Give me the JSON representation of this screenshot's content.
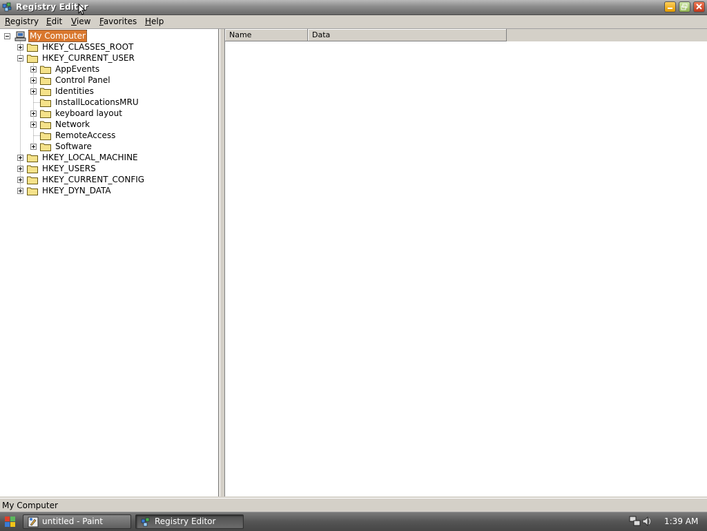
{
  "window": {
    "title": "Registry Editor",
    "buttons": [
      "minimize",
      "maximize",
      "close"
    ],
    "title_gradient": [
      "#b9b9b9",
      "#6a6a6a"
    ]
  },
  "menubar": {
    "items": [
      {
        "pre": "",
        "acc": "R",
        "post": "egistry"
      },
      {
        "pre": "",
        "acc": "E",
        "post": "dit"
      },
      {
        "pre": "",
        "acc": "V",
        "post": "iew"
      },
      {
        "pre": "",
        "acc": "F",
        "post": "avorites"
      },
      {
        "pre": "",
        "acc": "H",
        "post": "elp"
      }
    ]
  },
  "tree": {
    "root": {
      "label": "My Computer",
      "selected": true,
      "icon": "computer-icon"
    },
    "hives": [
      {
        "label": "HKEY_CLASSES_ROOT",
        "expander": "plus"
      },
      {
        "label": "HKEY_CURRENT_USER",
        "expander": "minus",
        "children": [
          {
            "label": "AppEvents",
            "expander": "plus"
          },
          {
            "label": "Control Panel",
            "expander": "plus"
          },
          {
            "label": "Identities",
            "expander": "plus"
          },
          {
            "label": "InstallLocationsMRU",
            "expander": "none"
          },
          {
            "label": "keyboard layout",
            "expander": "plus"
          },
          {
            "label": "Network",
            "expander": "plus"
          },
          {
            "label": "RemoteAccess",
            "expander": "none"
          },
          {
            "label": "Software",
            "expander": "plus"
          }
        ]
      },
      {
        "label": "HKEY_LOCAL_MACHINE",
        "expander": "plus"
      },
      {
        "label": "HKEY_USERS",
        "expander": "plus"
      },
      {
        "label": "HKEY_CURRENT_CONFIG",
        "expander": "plus"
      },
      {
        "label": "HKEY_DYN_DATA",
        "expander": "plus"
      }
    ],
    "selection_color": "#d9772d"
  },
  "list": {
    "columns": [
      "Name",
      "Data"
    ]
  },
  "statusbar": {
    "text": "My Computer"
  },
  "taskbar": {
    "tasks": [
      {
        "label": "untitled - Paint",
        "icon": "paint-icon",
        "active": false
      },
      {
        "label": "Registry Editor",
        "icon": "registry-icon",
        "active": true
      }
    ],
    "clock": "1:39 AM",
    "tray_icons": [
      "network-icon",
      "volume-icon"
    ]
  }
}
